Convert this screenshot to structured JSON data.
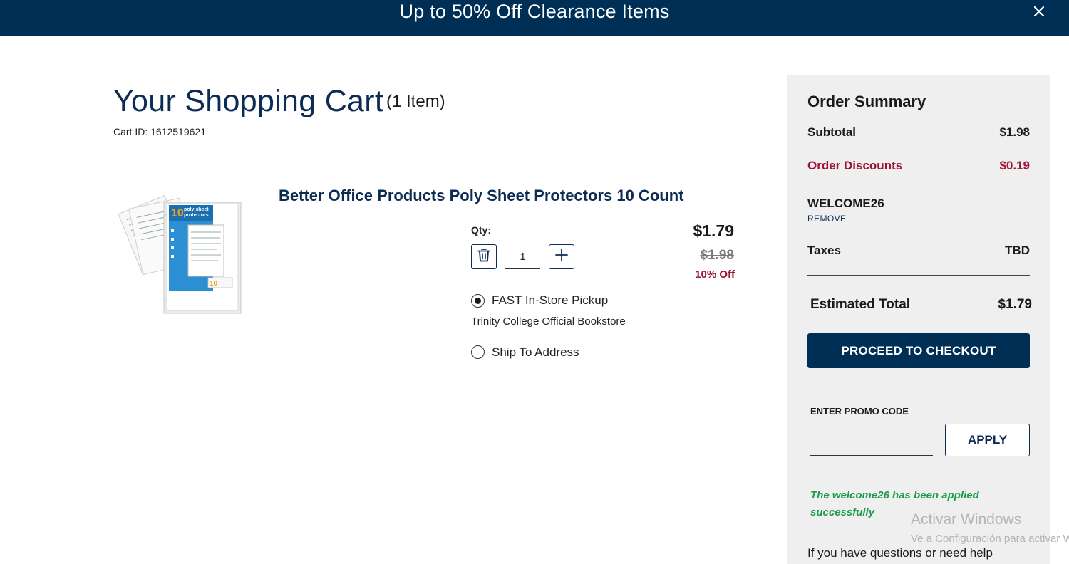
{
  "banner": {
    "text": "Up to 50% Off Clearance Items",
    "close_icon": "close-icon"
  },
  "cart": {
    "title": "Your Shopping Cart",
    "item_count": "(1 Item)",
    "cart_id": "Cart ID: 1612519621"
  },
  "item": {
    "title": "Better Office Products Poly Sheet Protectors 10 Count",
    "image_badge_number": "10",
    "image_badge_text_1": "poly sheet",
    "image_badge_text_2": "protectors",
    "qty_label": "Qty:",
    "qty_value": "1",
    "price": "$1.79",
    "original_price": "$1.98",
    "discount": "10% Off",
    "fulfillment": {
      "pickup_label": "FAST In-Store Pickup",
      "pickup_selected": true,
      "store_name": "Trinity College Official Bookstore",
      "ship_label": "Ship To Address",
      "ship_selected": false
    }
  },
  "summary": {
    "title": "Order Summary",
    "subtotal_label": "Subtotal",
    "subtotal_value": "$1.98",
    "discounts_label": "Order Discounts",
    "discounts_value": "$0.19",
    "promo_code": "WELCOME26",
    "remove_label": "REMOVE",
    "taxes_label": "Taxes",
    "taxes_value": "TBD",
    "total_label": "Estimated Total",
    "total_value": "$1.79",
    "checkout_label": "PROCEED TO CHECKOUT",
    "promo_input_label": "ENTER PROMO CODE",
    "promo_input_value": "",
    "apply_label": "APPLY",
    "promo_success": "The welcome26 has been applied successfully",
    "help_text": "If you have questions or need help"
  },
  "watermark": {
    "title": "Activar Windows",
    "subtitle": "Ve a Configuración para activar Windows."
  },
  "colors": {
    "brand_navy": "#002f56",
    "heading_navy": "#0d2c54",
    "discount_red": "#9b1434",
    "success_green": "#1a9c4a",
    "summary_bg": "#efefef"
  }
}
